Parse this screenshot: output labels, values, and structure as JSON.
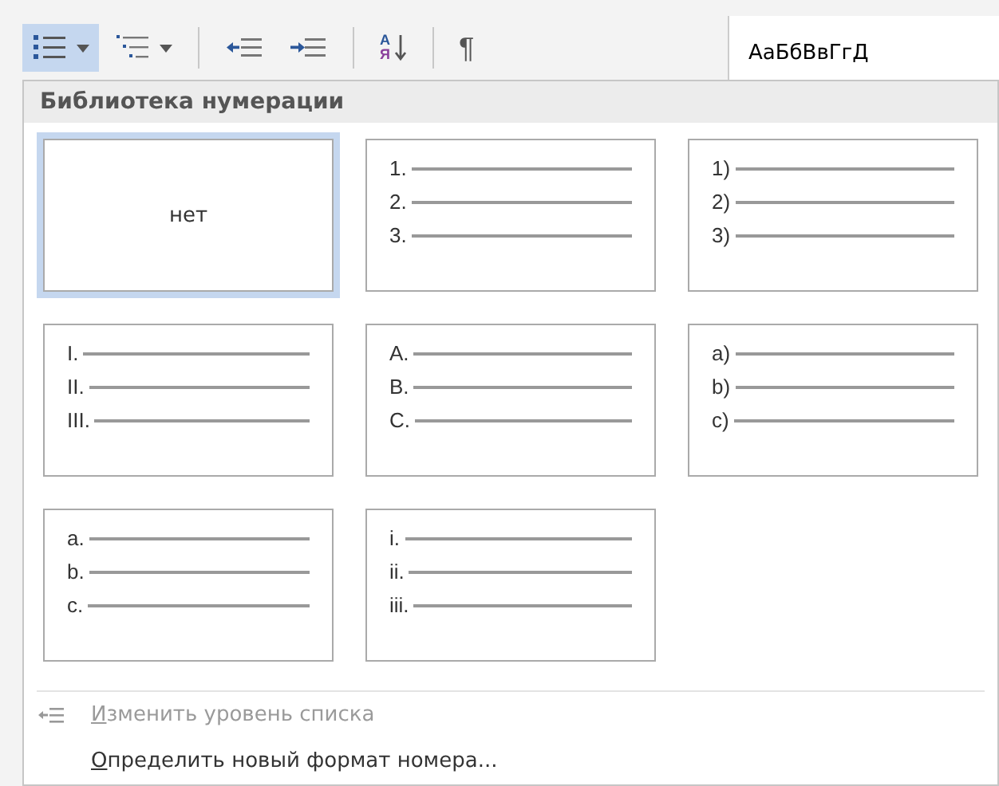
{
  "toolbar": [
    {
      "kind": "numbering",
      "dropdown": true,
      "selected": true
    },
    {
      "kind": "multilevel",
      "dropdown": true,
      "selected": false
    },
    {
      "kind": "separator"
    },
    {
      "kind": "outdent",
      "selected": false
    },
    {
      "kind": "indent",
      "selected": false
    },
    {
      "kind": "separator"
    },
    {
      "kind": "sort",
      "text_top": "А",
      "text_bottom": "Я",
      "selected": false
    },
    {
      "kind": "separator"
    },
    {
      "kind": "pilcrow",
      "text": "¶",
      "selected": false
    }
  ],
  "style_preview": "АаБбВвГгД",
  "panel": {
    "title": "Библиотека нумерации",
    "tiles": [
      {
        "kind": "none",
        "label": "нет",
        "selected": true
      },
      {
        "kind": "list",
        "markers": [
          "1.",
          "2.",
          "3."
        ],
        "selected": false
      },
      {
        "kind": "list",
        "markers": [
          "1)",
          "2)",
          "3)"
        ],
        "selected": false
      },
      {
        "kind": "list",
        "markers": [
          "I.",
          "II.",
          "III."
        ],
        "selected": false
      },
      {
        "kind": "list",
        "markers": [
          "A.",
          "B.",
          "C."
        ],
        "selected": false
      },
      {
        "kind": "list",
        "markers": [
          "a)",
          "b)",
          "c)"
        ],
        "selected": false
      },
      {
        "kind": "list",
        "markers": [
          "a.",
          "b.",
          "c."
        ],
        "selected": false
      },
      {
        "kind": "list",
        "markers": [
          "i.",
          "ii.",
          "iii."
        ],
        "selected": false
      }
    ],
    "menu": [
      {
        "kind": "level_change",
        "mnemonic": "И",
        "rest": "зменить уровень списка",
        "disabled": true
      },
      {
        "kind": "define_format",
        "mnemonic": "О",
        "rest": "пределить новый формат номера...",
        "disabled": false
      }
    ]
  }
}
